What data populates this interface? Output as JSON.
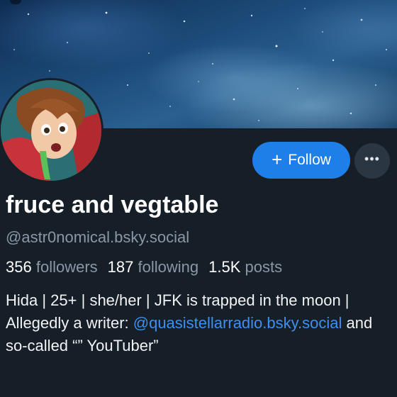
{
  "profile": {
    "display_name": "fruce and vegtable",
    "handle": "@astr0nomical.bsky.social",
    "stats": {
      "followers_count": "356",
      "followers_label": "followers",
      "following_count": "187",
      "following_label": "following",
      "posts_count": "1.5K",
      "posts_label": "posts"
    },
    "bio": {
      "text_1": "Hida | 25+ | she/her | JFK is trapped in the moon | Allegedly a writer: ",
      "link": "@quasistellarradio.bsky.social",
      "text_2": " and so-called “” YouTuber”"
    }
  },
  "actions": {
    "follow_icon": "+",
    "follow_label": "Follow",
    "more_label": "•••"
  },
  "icons": {
    "follow": "plus-icon",
    "more": "ellipsis-icon"
  },
  "colors": {
    "background": "#161e27",
    "accent": "#1f7fe8",
    "link": "#3b90f2",
    "muted_text": "#8b97a6"
  }
}
